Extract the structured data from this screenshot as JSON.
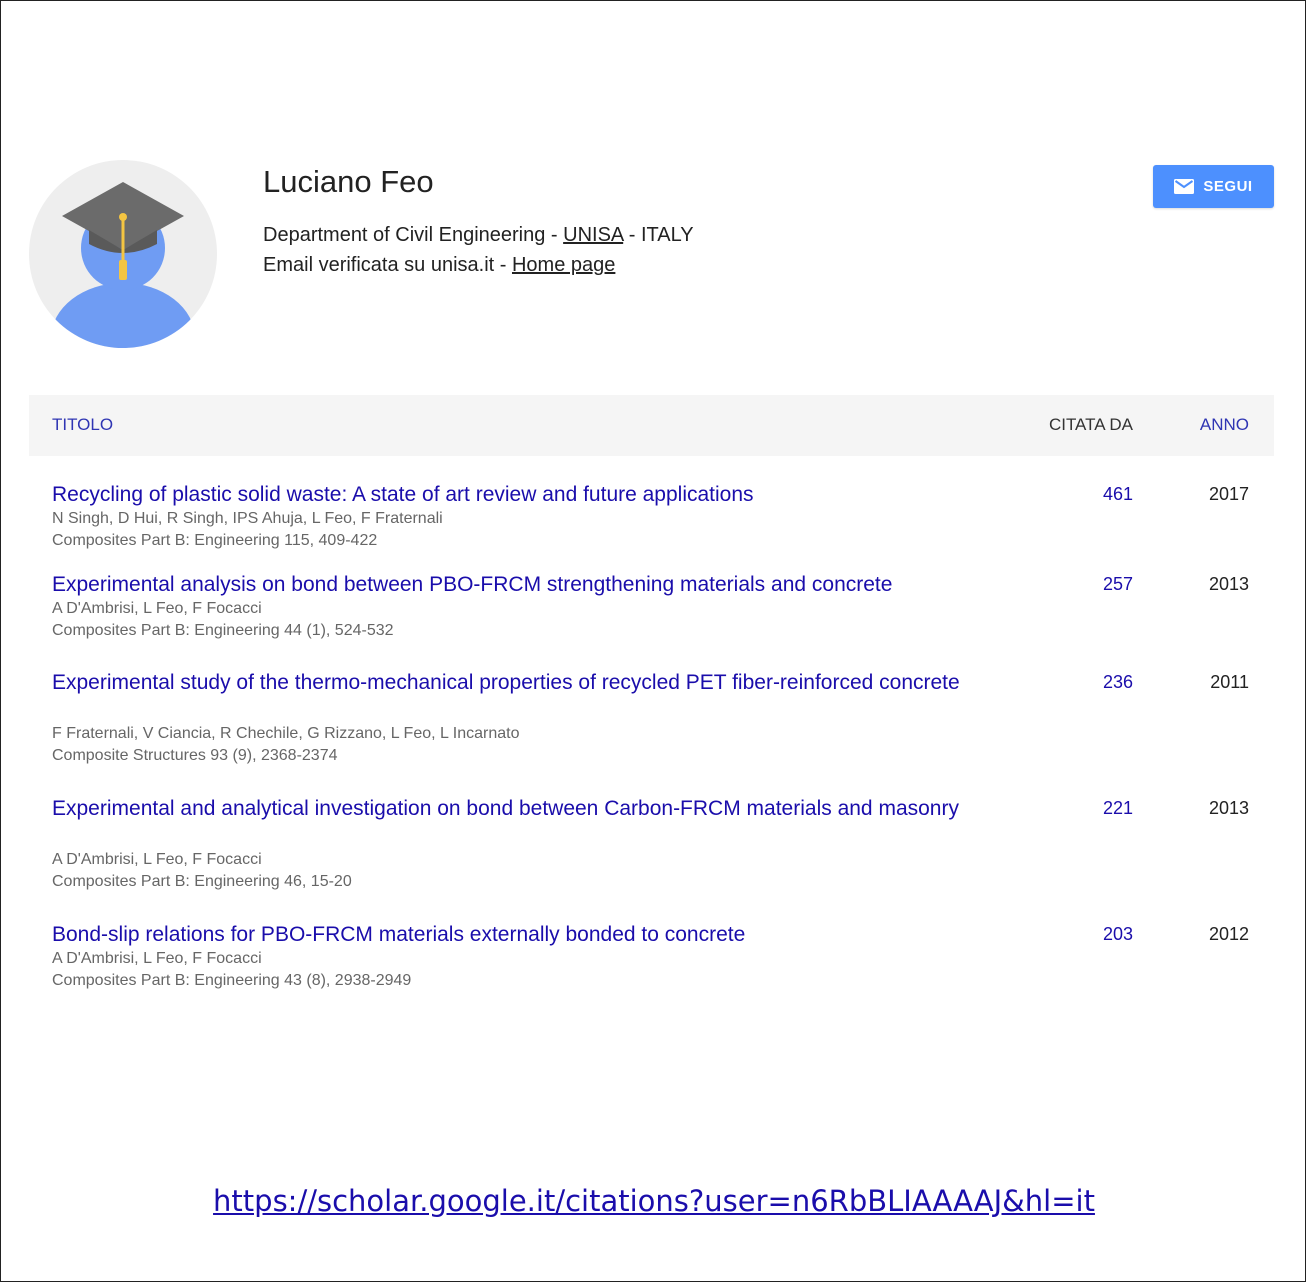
{
  "profile": {
    "name": "Luciano Feo",
    "affiliation_prefix": "Department of Civil Engineering - ",
    "affiliation_link": "UNISA",
    "affiliation_suffix": " - ITALY",
    "email_text": "Email verificata su unisa.it - ",
    "homepage_link": "Home page",
    "follow_label": "SEGUI"
  },
  "table": {
    "headers": {
      "title": "TITOLO",
      "cited": "CITATA DA",
      "year": "ANNO"
    },
    "rows": [
      {
        "title": "Recycling of plastic solid waste: A state of art review and future applications",
        "authors": "N Singh, D Hui, R Singh, IPS Ahuja, L Feo, F Fraternali",
        "venue": "Composites Part B: Engineering 115, 409-422",
        "cited": "461",
        "year": "2017"
      },
      {
        "title": "Experimental analysis on bond between PBO-FRCM strengthening materials and concrete",
        "authors": "A D'Ambrisi, L Feo, F Focacci",
        "venue": "Composites Part B: Engineering 44 (1), 524-532",
        "cited": "257",
        "year": "2013"
      },
      {
        "title": "Experimental study of the thermo-mechanical properties of recycled PET fiber-reinforced concrete",
        "authors": "F Fraternali, V Ciancia, R Chechile, G Rizzano, L Feo, L Incarnato",
        "venue": "Composite Structures 93 (9), 2368-2374",
        "cited": "236",
        "year": "2011"
      },
      {
        "title": "Experimental and analytical investigation on bond between Carbon-FRCM materials and masonry",
        "authors": "A D'Ambrisi, L Feo, F Focacci",
        "venue": "Composites Part B: Engineering 46, 15-20",
        "cited": "221",
        "year": "2013"
      },
      {
        "title": "Bond-slip relations for PBO-FRCM materials externally bonded to concrete",
        "authors": "A D'Ambrisi, L Feo, F Focacci",
        "venue": "Composites Part B: Engineering 43 (8), 2938-2949",
        "cited": "203",
        "year": "2012"
      }
    ]
  },
  "footer": {
    "url": "https://scholar.google.it/citations?user=n6RbBLIAAAAJ&hl=it"
  },
  "colors": {
    "link": "#1a0dab",
    "button": "#4d90fe",
    "avatar_body": "#6f9cf3",
    "avatar_bg": "#eeeeee",
    "cap": "#6b6b6b",
    "tassel": "#f4c542"
  },
  "icons": {
    "avatar": "graduate-avatar-icon",
    "follow": "envelope-icon"
  }
}
